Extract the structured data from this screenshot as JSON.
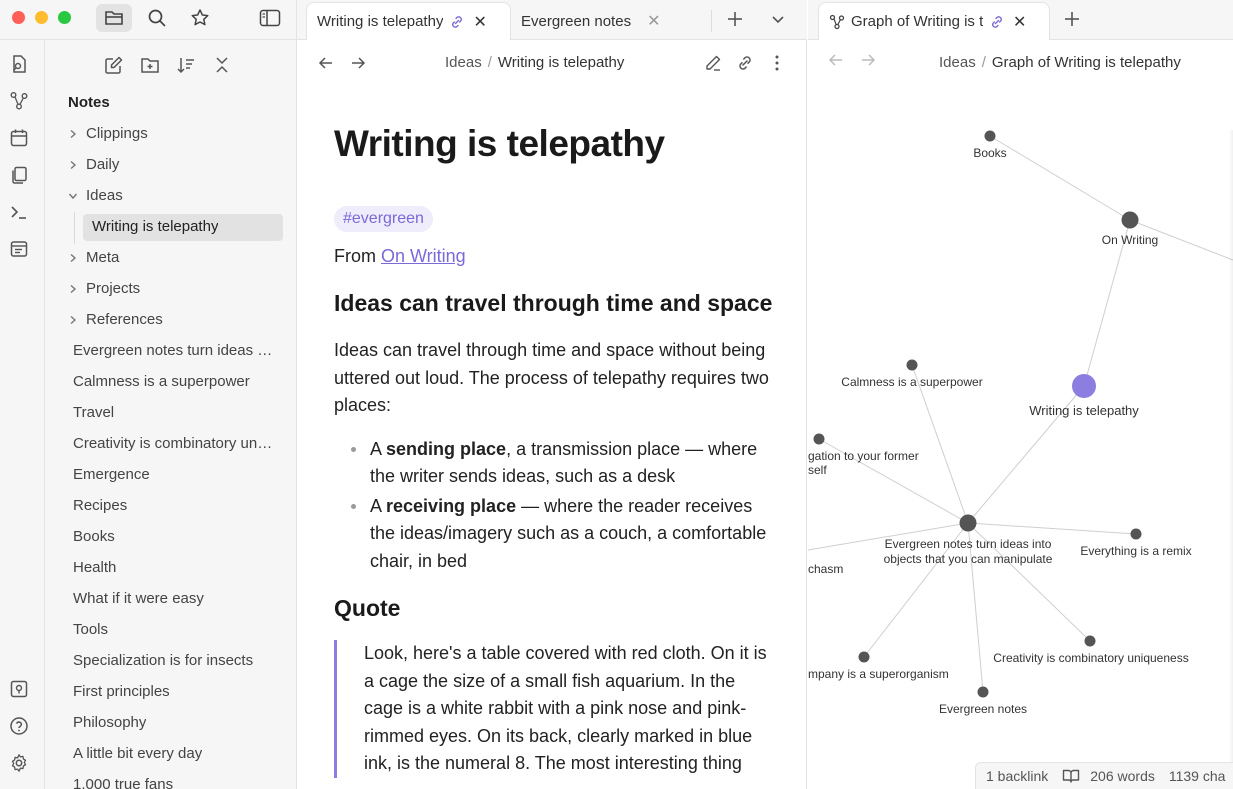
{
  "sidebar_tabs": {
    "files_icon": "folder-icon",
    "search_icon": "search-icon",
    "bookmarks_icon": "star-icon",
    "toggle_icon": "sidebar-toggle-icon"
  },
  "tabs_left": [
    {
      "title": "Writing is telepathy",
      "active": true
    },
    {
      "title": "Evergreen notes",
      "active": false
    }
  ],
  "tabs_right": [
    {
      "title": "Graph of Writing is telepathy",
      "active": true
    }
  ],
  "ribbon": [
    "open-quick-switcher-icon",
    "graph-view-icon",
    "daily-note-icon",
    "templates-icon",
    "command-palette-icon",
    "canvas-icon",
    "vault-switcher-icon",
    "help-icon",
    "settings-icon"
  ],
  "explorer": {
    "vault": "Notes",
    "folders": [
      {
        "label": "Clippings",
        "expanded": false
      },
      {
        "label": "Daily",
        "expanded": false
      },
      {
        "label": "Ideas",
        "expanded": true,
        "children": [
          "Writing is telepathy"
        ]
      },
      {
        "label": "Meta",
        "expanded": false
      },
      {
        "label": "Projects",
        "expanded": false
      },
      {
        "label": "References",
        "expanded": false
      }
    ],
    "files": [
      "Evergreen notes turn ideas into objects that you can manipulate",
      "Calmness is a superpower",
      "Travel",
      "Creativity is combinatory uniqueness",
      "Emergence",
      "Recipes",
      "Books",
      "Health",
      "What if it were easy",
      "Tools",
      "Specialization is for insects",
      "First principles",
      "Philosophy",
      "A little bit every day",
      "1,000 true fans"
    ]
  },
  "editor": {
    "breadcrumb_parent": "Ideas",
    "breadcrumb_sep": "/",
    "breadcrumb_current": "Writing is telepathy",
    "title": "Writing is telepathy",
    "tag": "#evergreen",
    "from_prefix": "From ",
    "from_link": "On Writing",
    "heading1": "Ideas can travel through time and space",
    "paragraph1": "Ideas can travel through time and space without being uttered out loud. The process of telepathy requires two places:",
    "bullets": [
      {
        "pre": "A ",
        "bold": "sending place",
        "post": ", a transmission place — where the writer sends ideas, such as a desk"
      },
      {
        "pre": "A ",
        "bold": "receiving place",
        "post": " — where the reader receives the ideas/imagery such as a couch, a comfortable chair, in bed"
      }
    ],
    "heading2": "Quote",
    "quote": "Look, here's a table covered with red cloth. On it is a cage the size of a small fish aquarium. In the cage is a white rabbit with a pink nose and pink-rimmed eyes. On its back, clearly marked in blue ink, is the numeral 8. The most interesting thing"
  },
  "graph": {
    "breadcrumb_parent": "Ideas",
    "breadcrumb_sep": "/",
    "breadcrumb_current": "Graph of Writing is telepathy",
    "accent": "#8b7ee0",
    "node_color": "#555555",
    "nodes": {
      "books": "Books",
      "on_writing": "On Writing",
      "calmness": "Calmness is a superpower",
      "telepathy": "Writing is telepathy",
      "former_self": "gation to your former self",
      "evergreen_hub": "Evergreen notes turn ideas into objects that you can manipulate",
      "remix": "Everything is a remix",
      "chasm": "chasm",
      "superorganism": "mpany is a superorganism",
      "creativity": "Creativity is combinatory uniqueness",
      "evergreen_notes": "Evergreen notes"
    }
  },
  "status": {
    "backlinks": "1 backlink",
    "words": "206 words",
    "chars": "1139 cha"
  }
}
